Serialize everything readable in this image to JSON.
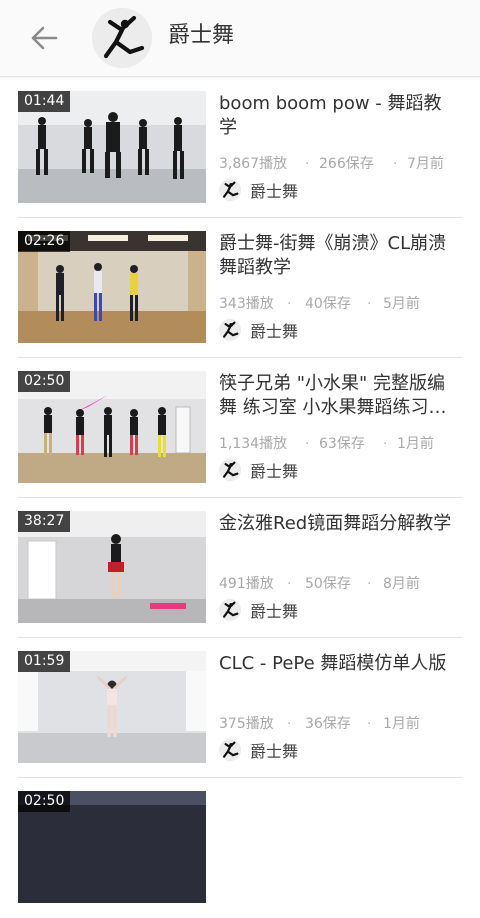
{
  "header": {
    "back_icon": "arrow-left-icon",
    "avatar_icon": "dancer-avatar",
    "title": "爵士舞"
  },
  "videos": [
    {
      "duration": "01:44",
      "title": "boom boom pow - 舞蹈教学",
      "plays": "3,867播放",
      "saves": "266保存",
      "time": "7月前",
      "author": "爵士舞"
    },
    {
      "duration": "02:26",
      "title": "爵士舞-街舞《崩溃》CL崩溃舞蹈教学",
      "plays": "343播放",
      "saves": "40保存",
      "time": "5月前",
      "author": "爵士舞"
    },
    {
      "duration": "02:50",
      "title": "筷子兄弟 \"小水果\" 完整版编舞 练习室 小水果舞蹈练习…",
      "plays": "1,134播放",
      "saves": "63保存",
      "time": "1月前",
      "author": "爵士舞"
    },
    {
      "duration": "38:27",
      "title": "金泫雅Red镜面舞蹈分解教学",
      "plays": "491播放",
      "saves": "50保存",
      "time": "8月前",
      "author": "爵士舞"
    },
    {
      "duration": "01:59",
      "title": "CLC - PePe 舞蹈模仿单人版",
      "plays": "375播放",
      "saves": "36保存",
      "time": "1月前",
      "author": "爵士舞"
    },
    {
      "duration": "02:50",
      "title": "",
      "plays": "",
      "saves": "",
      "time": "",
      "author": ""
    }
  ],
  "separator": "·",
  "colors": {
    "header_bg": "#fafafa",
    "title_text": "#333333",
    "meta_text": "#a8a8a8",
    "divider": "#e4e4e4"
  }
}
